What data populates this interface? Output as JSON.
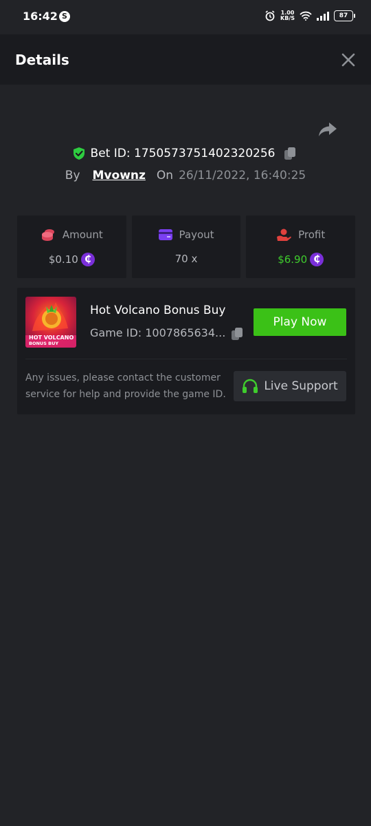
{
  "status_bar": {
    "time": "16:42",
    "s_icon": "S",
    "net_speed_top": "1.00",
    "net_speed_bottom": "KB/S",
    "battery": "87"
  },
  "header": {
    "title": "Details"
  },
  "bet": {
    "id_label": "Bet ID: 1750573751402320256",
    "by_label": "By",
    "username": "Mvownz",
    "on_label": "On",
    "date": "26/11/2022, 16:40:25"
  },
  "stats": [
    {
      "label": "Amount",
      "value": "$0.10",
      "icon": "coins-icon",
      "color": "#d9445a",
      "coin": true,
      "green": false
    },
    {
      "label": "Payout",
      "value": "70 x",
      "icon": "card-icon",
      "color": "#7a3ff2",
      "coin": false,
      "green": false
    },
    {
      "label": "Profit",
      "value": "$6.90",
      "icon": "hand-coin-icon",
      "color": "#e0413d",
      "coin": true,
      "green": true
    }
  ],
  "coin_symbol": "₵",
  "game": {
    "name": "Hot Volcano Bonus Buy",
    "id_text": "Game ID: 1007865634...",
    "thumb_line1": "HOT VOLCANO",
    "thumb_line2": "BONUS BUY",
    "play_label": "Play Now",
    "help_text": "Any issues, please contact the customer service for help and provide the game ID.",
    "support_label": "Live Support"
  },
  "colors": {
    "background": "#222327",
    "card": "#1a1b1f",
    "accent_green": "#3bc117",
    "shield_green": "#2ecc40"
  }
}
